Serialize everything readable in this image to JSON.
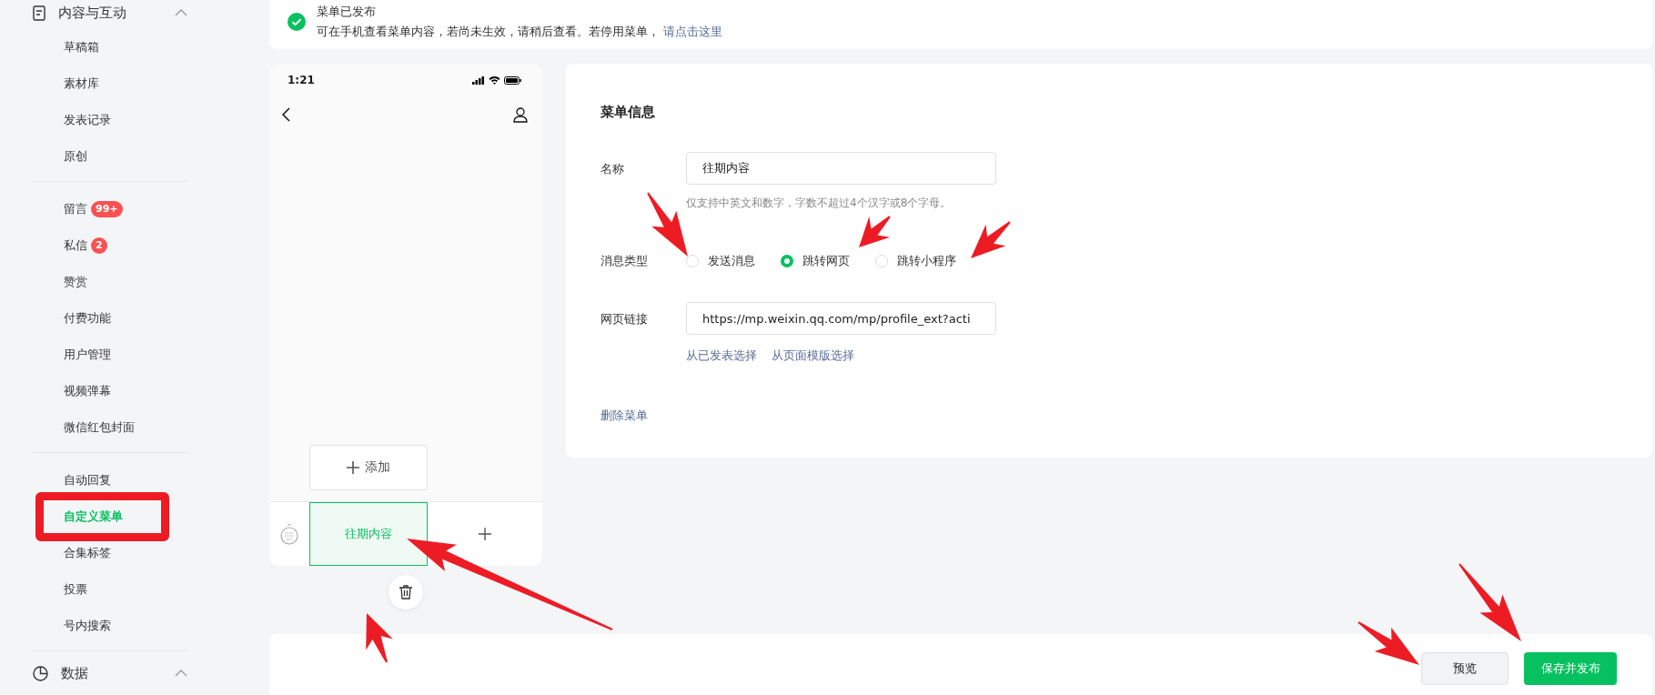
{
  "sidebar": {
    "top_section": {
      "label": "内容与互动",
      "expanded": true
    },
    "groups": [
      [
        {
          "label": "草稿箱",
          "selected": false
        },
        {
          "label": "素材库",
          "selected": false
        },
        {
          "label": "发表记录",
          "selected": false
        },
        {
          "label": "原创",
          "selected": false
        }
      ],
      [
        {
          "label": "留言",
          "selected": false,
          "badge": "99+"
        },
        {
          "label": "私信",
          "selected": false,
          "badge": "2"
        },
        {
          "label": "赞赏",
          "selected": false
        },
        {
          "label": "付费功能",
          "selected": false
        },
        {
          "label": "用户管理",
          "selected": false
        },
        {
          "label": "视频弹幕",
          "selected": false
        },
        {
          "label": "微信红包封面",
          "selected": false
        }
      ],
      [
        {
          "label": "自动回复",
          "selected": false
        },
        {
          "label": "自定义菜单",
          "selected": true
        },
        {
          "label": "合集标签",
          "selected": false
        },
        {
          "label": "投票",
          "selected": false
        },
        {
          "label": "号内搜索",
          "selected": false
        }
      ]
    ],
    "bottom_section": {
      "label": "数据",
      "expanded": true
    }
  },
  "notice": {
    "title": "菜单已发布",
    "message": "可在手机查看菜单内容，若尚未生效，请稍后查看。若停用菜单，",
    "link": "请点击这里"
  },
  "phone": {
    "time": "1:21",
    "add_button": "添加",
    "menu_items": [
      {
        "label": "往期内容",
        "selected": true
      }
    ]
  },
  "form": {
    "title": "菜单信息",
    "name": {
      "label": "名称",
      "value": "往期内容",
      "hint": "仅支持中英文和数字，字数不超过4个汉字或8个字母。"
    },
    "type": {
      "label": "消息类型",
      "options": [
        {
          "label": "发送消息",
          "selected": false
        },
        {
          "label": "跳转网页",
          "selected": true
        },
        {
          "label": "跳转小程序",
          "selected": false
        }
      ]
    },
    "url": {
      "label": "网页链接",
      "value": "https://mp.weixin.qq.com/mp/profile_ext?acti",
      "links": [
        "从已发表选择",
        "从页面模版选择"
      ]
    },
    "delete_link": "删除菜单"
  },
  "footer": {
    "buttons": [
      {
        "label": "预览",
        "kind": "secondary"
      },
      {
        "label": "保存并发布",
        "kind": "primary"
      }
    ]
  }
}
